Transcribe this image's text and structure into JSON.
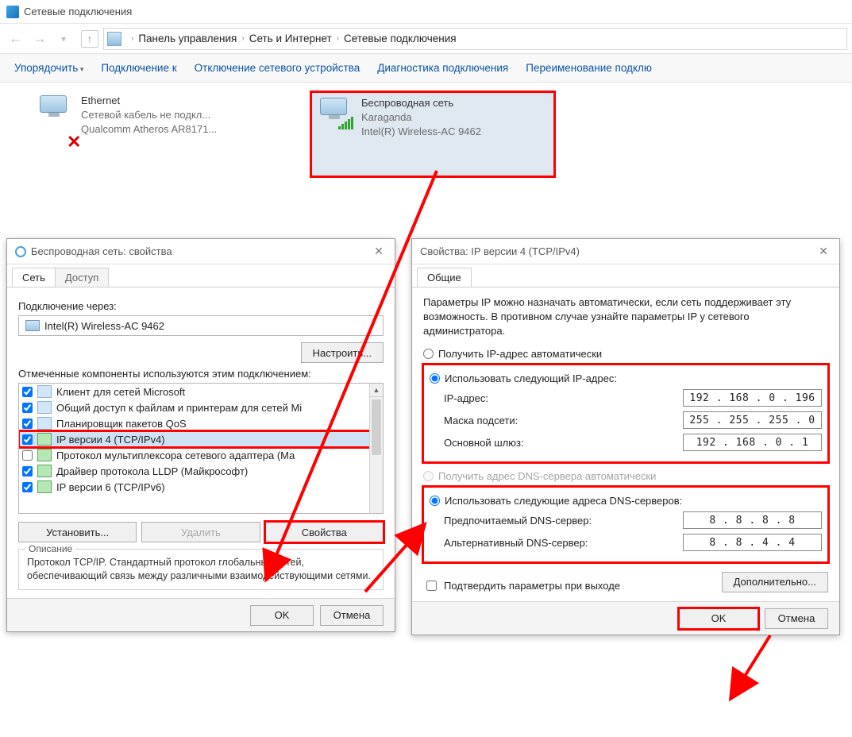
{
  "window": {
    "title": "Сетевые подключения"
  },
  "breadcrumb": {
    "a": "Панель управления",
    "b": "Сеть и Интернет",
    "c": "Сетевые подключения"
  },
  "toolbar": {
    "organize": "Упорядочить",
    "connect": "Подключение к",
    "disable": "Отключение сетевого устройства",
    "diagnose": "Диагностика подключения",
    "rename": "Переименование подклю"
  },
  "connections": {
    "eth": {
      "name": "Ethernet",
      "status": "Сетевой кабель не подкл...",
      "device": "Qualcomm Atheros AR8171..."
    },
    "wifi": {
      "name": "Беспроводная сеть",
      "ssid": "Karaganda",
      "device": "Intel(R) Wireless-AC 9462"
    }
  },
  "props": {
    "title": "Беспроводная сеть: свойства",
    "tab_net": "Сеть",
    "tab_access": "Доступ",
    "connect_via": "Подключение через:",
    "adapter": "Intel(R) Wireless-AC 9462",
    "configure": "Настроить...",
    "components_label": "Отмеченные компоненты используются этим подключением:",
    "items": [
      "Клиент для сетей Microsoft",
      "Общий доступ к файлам и принтерам для сетей Mi",
      "Планировщик пакетов QoS",
      "IP версии 4 (TCP/IPv4)",
      "Протокол мультиплексора сетевого адаптера (Ма",
      "Драйвер протокола LLDP (Майкрософт)",
      "IP версии 6 (TCP/IPv6)"
    ],
    "install": "Установить...",
    "remove": "Удалить",
    "properties": "Свойства",
    "desc_title": "Описание",
    "desc": "Протокол TCP/IP. Стандартный протокол глобальных сетей, обеспечивающий связь между различными взаимодействующими сетями.",
    "ok": "OK",
    "cancel": "Отмена"
  },
  "ip4": {
    "title": "Свойства: IP версии 4 (TCP/IPv4)",
    "tab": "Общие",
    "intro": "Параметры IP можно назначать автоматически, если сеть поддерживает эту возможность. В противном случае узнайте параметры IP у сетевого администратора.",
    "auto_ip": "Получить IP-адрес автоматически",
    "use_ip": "Использовать следующий IP-адрес:",
    "ip_label": "IP-адрес:",
    "ip_val": "192 . 168 .  0  . 196",
    "mask_label": "Маска подсети:",
    "mask_val": "255 . 255 . 255 .  0",
    "gw_label": "Основной шлюз:",
    "gw_val": "192 . 168 .  0  .  1",
    "auto_dns": "Получить адрес DNS-сервера автоматически",
    "use_dns": "Использовать следующие адреса DNS-серверов:",
    "dns1_label": "Предпочитаемый DNS-сервер:",
    "dns1_val": "8  .  8  .  8  .  8",
    "dns2_label": "Альтернативный DNS-сервер:",
    "dns2_val": "8  .  8  .  4  .  4",
    "confirm_exit": "Подтвердить параметры при выходе",
    "advanced": "Дополнительно...",
    "ok": "OK",
    "cancel": "Отмена"
  }
}
